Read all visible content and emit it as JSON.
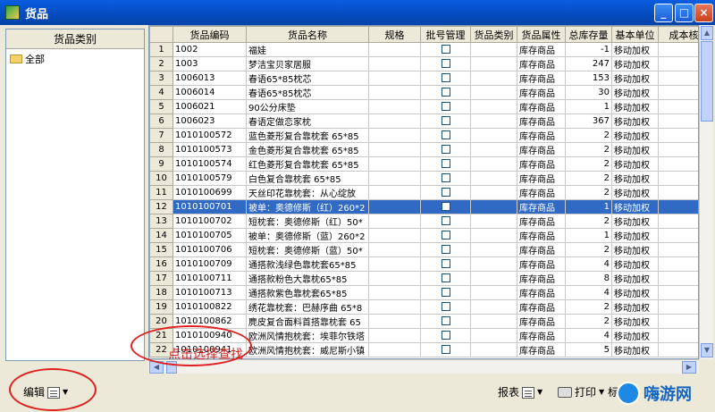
{
  "window": {
    "title": "货品",
    "controls": [
      "_",
      "□",
      "×"
    ]
  },
  "left_panel": {
    "header": "货品类别",
    "tree": [
      {
        "label": "全部",
        "icon": "folder-icon"
      }
    ]
  },
  "grid": {
    "columns": [
      "",
      "货品编码",
      "货品名称",
      "规格",
      "批号管理",
      "货品类别",
      "货品属性",
      "总库存量",
      "基本单位",
      "成本核"
    ],
    "selected_row": 12,
    "rows": [
      {
        "n": "1",
        "code": "1002",
        "name": "福娃",
        "attr": "库存商品",
        "qty": "-1",
        "unit": "移动加权"
      },
      {
        "n": "2",
        "code": "1003",
        "name": "梦洁宝贝家居服",
        "attr": "库存商品",
        "qty": "247",
        "unit": "移动加权"
      },
      {
        "n": "3",
        "code": "1006013",
        "name": "春语65*85枕芯",
        "attr": "库存商品",
        "qty": "153",
        "unit": "移动加权"
      },
      {
        "n": "4",
        "code": "1006014",
        "name": "春语65*85枕芯",
        "attr": "库存商品",
        "qty": "30",
        "unit": "移动加权"
      },
      {
        "n": "5",
        "code": "1006021",
        "name": "90公分床垫",
        "attr": "库存商品",
        "qty": "1",
        "unit": "移动加权"
      },
      {
        "n": "6",
        "code": "1006023",
        "name": "春语定做恋家枕",
        "attr": "库存商品",
        "qty": "367",
        "unit": "移动加权"
      },
      {
        "n": "7",
        "code": "1010100572",
        "name": "蓝色菱形复合靠枕套 65*85",
        "attr": "库存商品",
        "qty": "2",
        "unit": "移动加权"
      },
      {
        "n": "8",
        "code": "1010100573",
        "name": "金色菱形复合靠枕套 65*85",
        "attr": "库存商品",
        "qty": "2",
        "unit": "移动加权"
      },
      {
        "n": "9",
        "code": "1010100574",
        "name": "红色菱形复合靠枕套 65*85",
        "attr": "库存商品",
        "qty": "2",
        "unit": "移动加权"
      },
      {
        "n": "10",
        "code": "1010100579",
        "name": "白色复合靠枕套 65*85",
        "attr": "库存商品",
        "qty": "2",
        "unit": "移动加权"
      },
      {
        "n": "11",
        "code": "1010100699",
        "name": "天丝印花靠枕套：从心绽放",
        "attr": "库存商品",
        "qty": "2",
        "unit": "移动加权"
      },
      {
        "n": "12",
        "code": "1010100701",
        "name": "被单：奥德修斯（红）260*2",
        "attr": "库存商品",
        "qty": "1",
        "unit": "移动加权"
      },
      {
        "n": "13",
        "code": "1010100702",
        "name": "短枕套：奥德修斯（红）50*",
        "attr": "库存商品",
        "qty": "2",
        "unit": "移动加权"
      },
      {
        "n": "14",
        "code": "1010100705",
        "name": "被单：奥德修斯（蓝）260*2",
        "attr": "库存商品",
        "qty": "1",
        "unit": "移动加权"
      },
      {
        "n": "15",
        "code": "1010100706",
        "name": "短枕套：奥德修斯（蓝）50*",
        "attr": "库存商品",
        "qty": "2",
        "unit": "移动加权"
      },
      {
        "n": "16",
        "code": "1010100709",
        "name": "通搭款浅绿色靠枕套65*85",
        "attr": "库存商品",
        "qty": "4",
        "unit": "移动加权"
      },
      {
        "n": "17",
        "code": "1010100711",
        "name": "通搭款粉色大靠枕65*85",
        "attr": "库存商品",
        "qty": "8",
        "unit": "移动加权"
      },
      {
        "n": "18",
        "code": "1010100713",
        "name": "通搭款紫色靠枕套65*85",
        "attr": "库存商品",
        "qty": "4",
        "unit": "移动加权"
      },
      {
        "n": "19",
        "code": "1010100822",
        "name": "绣花靠枕套：巴赫序曲 65*8",
        "attr": "库存商品",
        "qty": "2",
        "unit": "移动加权"
      },
      {
        "n": "20",
        "code": "1010100862",
        "name": "麂皮复合面料首搭靠枕套 65",
        "attr": "库存商品",
        "qty": "2",
        "unit": "移动加权"
      },
      {
        "n": "21",
        "code": "1010100940",
        "name": "欧洲风情抱枕套：埃菲尔铁塔",
        "attr": "库存商品",
        "qty": "4",
        "unit": "移动加权"
      },
      {
        "n": "22",
        "code": "1010100941",
        "name": "欧洲风情抱枕套：威尼斯小镇",
        "attr": "库存商品",
        "qty": "5",
        "unit": "移动加权"
      }
    ]
  },
  "toolbar": {
    "edit": "编辑",
    "report": "报表",
    "print": "打印",
    "extra": "标"
  },
  "annotation": {
    "hint": "点击选择查找"
  },
  "watermark": {
    "text": "嗨游网"
  }
}
